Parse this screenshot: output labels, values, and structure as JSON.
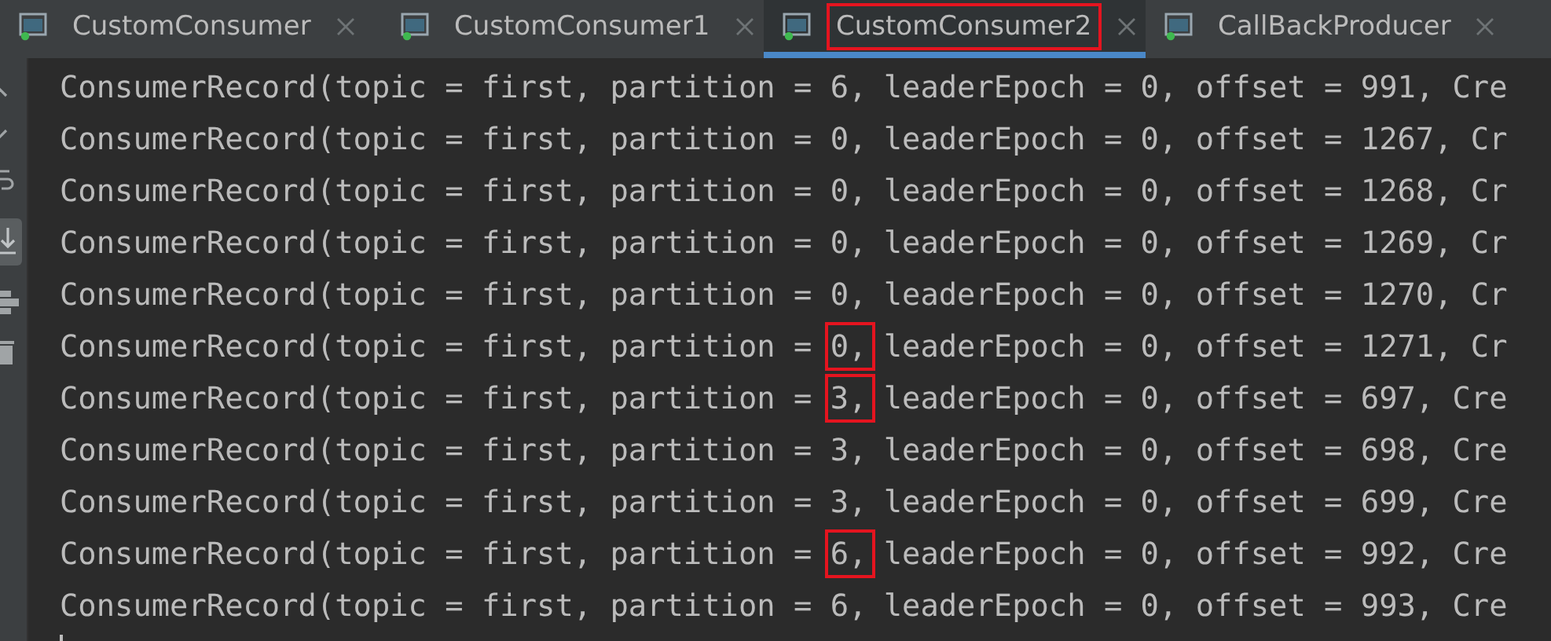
{
  "tabs": [
    {
      "label": "CustomConsumer",
      "selected": false,
      "highlighted": false
    },
    {
      "label": "CustomConsumer1",
      "selected": false,
      "highlighted": false
    },
    {
      "label": "CustomConsumer2",
      "selected": true,
      "highlighted": true
    },
    {
      "label": "CallBackProducer",
      "selected": false,
      "highlighted": false
    }
  ],
  "console_lines": [
    {
      "prefix": "ConsumerRecord(topic = first, partition = ",
      "partition": "6,",
      "rest": " leaderEpoch = 0, offset = 991, Cre",
      "highlighted": false
    },
    {
      "prefix": "ConsumerRecord(topic = first, partition = ",
      "partition": "0,",
      "rest": " leaderEpoch = 0, offset = 1267, Cr",
      "highlighted": false
    },
    {
      "prefix": "ConsumerRecord(topic = first, partition = ",
      "partition": "0,",
      "rest": " leaderEpoch = 0, offset = 1268, Cr",
      "highlighted": false
    },
    {
      "prefix": "ConsumerRecord(topic = first, partition = ",
      "partition": "0,",
      "rest": " leaderEpoch = 0, offset = 1269, Cr",
      "highlighted": false
    },
    {
      "prefix": "ConsumerRecord(topic = first, partition = ",
      "partition": "0,",
      "rest": " leaderEpoch = 0, offset = 1270, Cr",
      "highlighted": false
    },
    {
      "prefix": "ConsumerRecord(topic = first, partition = ",
      "partition": "0,",
      "rest": " leaderEpoch = 0, offset = 1271, Cr",
      "highlighted": true
    },
    {
      "prefix": "ConsumerRecord(topic = first, partition = ",
      "partition": "3,",
      "rest": " leaderEpoch = 0, offset = 697, Cre",
      "highlighted": true
    },
    {
      "prefix": "ConsumerRecord(topic = first, partition = ",
      "partition": "3,",
      "rest": " leaderEpoch = 0, offset = 698, Cre",
      "highlighted": false
    },
    {
      "prefix": "ConsumerRecord(topic = first, partition = ",
      "partition": "3,",
      "rest": " leaderEpoch = 0, offset = 699, Cre",
      "highlighted": false
    },
    {
      "prefix": "ConsumerRecord(topic = first, partition = ",
      "partition": "6,",
      "rest": " leaderEpoch = 0, offset = 992, Cre",
      "highlighted": true
    },
    {
      "prefix": "ConsumerRecord(topic = first, partition = ",
      "partition": "6,",
      "rest": " leaderEpoch = 0, offset = 993, Cre",
      "highlighted": false
    }
  ]
}
